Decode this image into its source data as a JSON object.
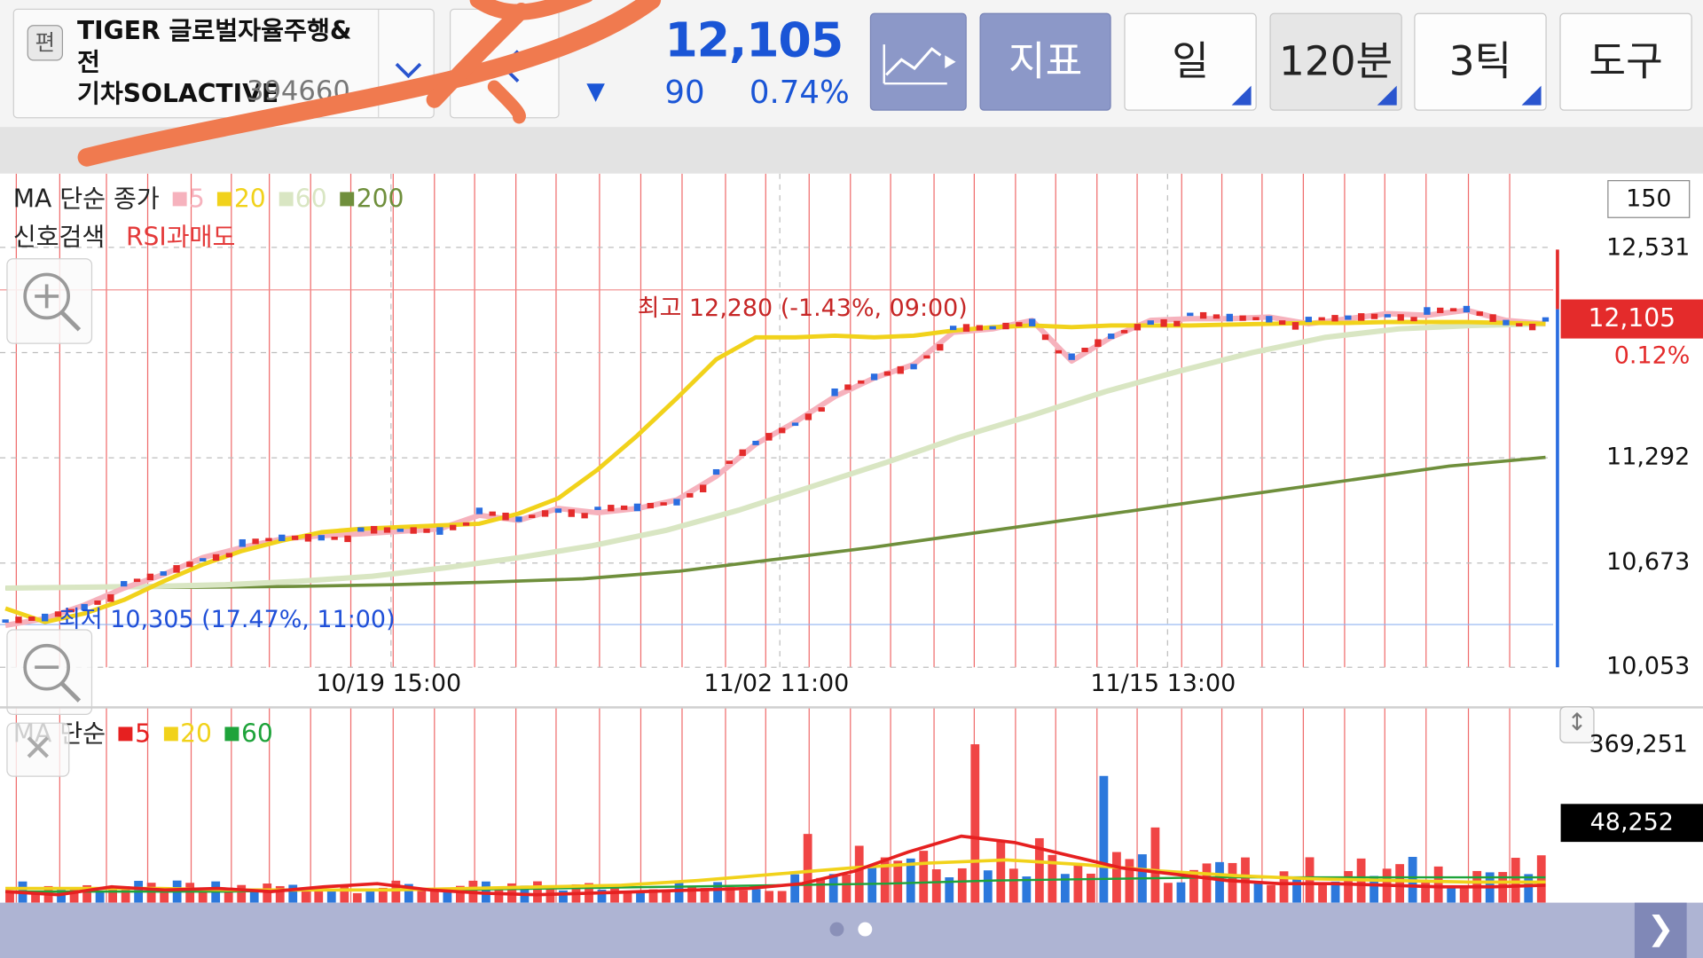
{
  "header": {
    "badge": "편",
    "stock_name": "TIGER 글로벌자율주행&전\n기차SOLACTIVE",
    "stock_code": "394660",
    "price": "12,105",
    "change": "90",
    "change_pct": "0.74%",
    "down_symbol": "▼",
    "buttons": {
      "indicator": "지표",
      "day": "일",
      "min120": "120분",
      "tick3": "3틱",
      "tools": "도구"
    }
  },
  "legend": {
    "price_ma_title": "MA 단순 종가",
    "price_ma": [
      {
        "label": "5",
        "color": "#f6b2bd"
      },
      {
        "label": "20",
        "color": "#f1d21b"
      },
      {
        "label": "60",
        "color": "#d9e6c3"
      },
      {
        "label": "200",
        "color": "#6f8f3c"
      }
    ],
    "signal_title": "신호검색",
    "signal_value": "RSI과매도",
    "volume_ma_title": "MA 단순",
    "volume_ma": [
      {
        "label": "5",
        "color": "#e62020"
      },
      {
        "label": "20",
        "color": "#f1d21b"
      },
      {
        "label": "60",
        "color": "#1ea33a"
      }
    ]
  },
  "chart": {
    "tick_count": "150",
    "current_price": "12,105",
    "current_pct": "0.12%",
    "high_label": "최고 12,280 (-1.43%, 09:00)",
    "low_label": "최저 10,305 (17.47%, 11:00)",
    "x_labels": [
      "10/19 15:00",
      "11/02 11:00",
      "11/15 13:00"
    ],
    "y_labels": [
      "12,531",
      "11,292",
      "10,673",
      "10,053"
    ],
    "vol_max": "369,251",
    "vol_current": "48,252"
  },
  "chart_data": {
    "type": "line",
    "ylim": [
      10053,
      12531
    ],
    "vol_max": 369251,
    "high": 12280,
    "low": 10305,
    "last": 12105,
    "series": [
      {
        "name": "5",
        "values": [
          10300,
          10340,
          10420,
          10520,
          10600,
          10700,
          10760,
          10810,
          10830,
          10840,
          10855,
          10870,
          10950,
          10920,
          10990,
          10965,
          10990,
          11040,
          11180,
          11370,
          11500,
          11650,
          11760,
          11840,
          12030,
          12050,
          12100,
          11860,
          12000,
          12100,
          12110,
          12110,
          12120,
          12080,
          12110,
          12140,
          12130,
          12160,
          12100,
          12080
        ]
      },
      {
        "name": "20",
        "values": [
          10400,
          10320,
          10370,
          10450,
          10560,
          10660,
          10740,
          10800,
          10850,
          10870,
          10880,
          10890,
          10900,
          10960,
          11050,
          11220,
          11420,
          11640,
          11870,
          12000,
          12000,
          12010,
          12000,
          12010,
          12040,
          12060,
          12070,
          12060,
          12070,
          12070,
          12070,
          12075,
          12080,
          12085,
          12085,
          12090,
          12090,
          12090,
          12085,
          12080
        ]
      },
      {
        "name": "60",
        "values": [
          10520,
          10525,
          10530,
          10540,
          10560,
          10590,
          10640,
          10700,
          10770,
          10860,
          10980,
          11120,
          11260,
          11410,
          11540,
          11680,
          11800,
          11910,
          12000,
          12050,
          12070,
          12080
        ]
      },
      {
        "name": "200",
        "values": [
          10520,
          10523,
          10525,
          10530,
          10540,
          10555,
          10575,
          10620,
          10690,
          10760,
          10840,
          10920,
          11000,
          11080,
          11160,
          11240,
          11292
        ]
      }
    ],
    "volume_ma5": [
      0.07,
      0.05,
      0.1,
      0.08,
      0.09,
      0.07,
      0.1,
      0.12,
      0.08,
      0.06,
      0.05,
      0.06,
      0.07,
      0.08,
      0.09,
      0.12,
      0.2,
      0.32,
      0.42,
      0.38,
      0.3,
      0.22,
      0.18,
      0.14,
      0.12,
      0.12,
      0.11,
      0.1,
      0.1,
      0.11
    ],
    "volume_ma20": [
      0.09,
      0.09,
      0.09,
      0.08,
      0.08,
      0.08,
      0.09,
      0.1,
      0.11,
      0.14,
      0.18,
      0.22,
      0.25,
      0.27,
      0.24,
      0.2,
      0.17,
      0.15,
      0.14,
      0.13,
      0.13
    ],
    "volume_ma60": [
      0.07,
      0.07,
      0.07,
      0.08,
      0.08,
      0.09,
      0.1,
      0.11,
      0.12,
      0.14,
      0.15,
      0.16,
      0.16,
      0.16,
      0.16
    ]
  }
}
